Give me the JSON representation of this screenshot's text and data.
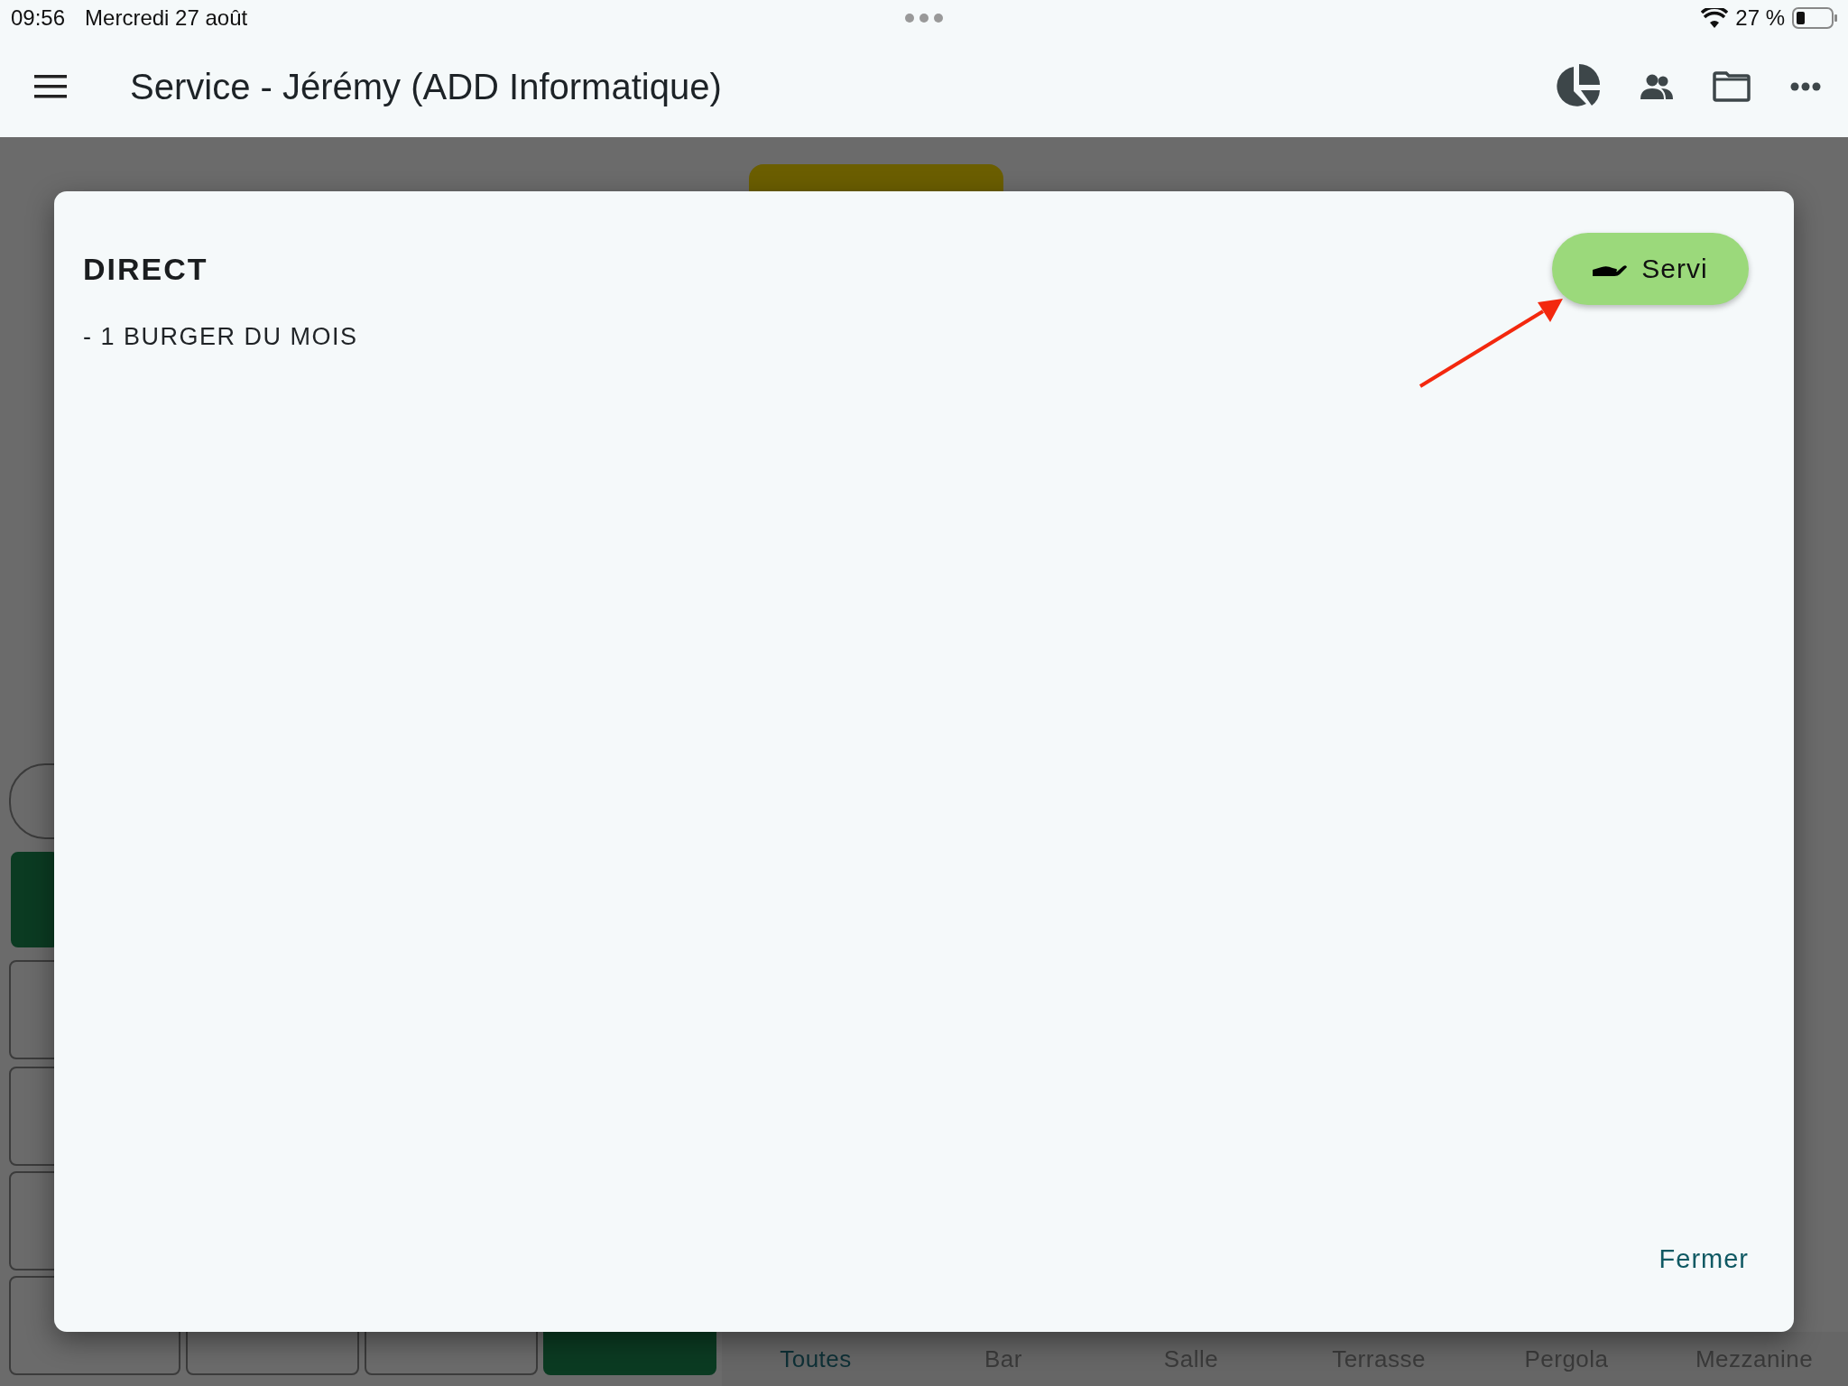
{
  "status_bar": {
    "time": "09:56",
    "date": "Mercredi 27 août",
    "battery": "27 %"
  },
  "app_bar": {
    "title": "Service - Jérémy (ADD Informatique)"
  },
  "dialog": {
    "title": "DIRECT",
    "lines": [
      "- 1 BURGER DU MOIS"
    ],
    "action_button": "Servi",
    "close_button": "Fermer"
  },
  "tabs": [
    {
      "label": "Toutes",
      "selected": true
    },
    {
      "label": "Bar",
      "selected": false
    },
    {
      "label": "Salle",
      "selected": false
    },
    {
      "label": "Terrasse",
      "selected": false
    },
    {
      "label": "Pergola",
      "selected": false
    },
    {
      "label": "Mezzanine",
      "selected": false
    }
  ]
}
